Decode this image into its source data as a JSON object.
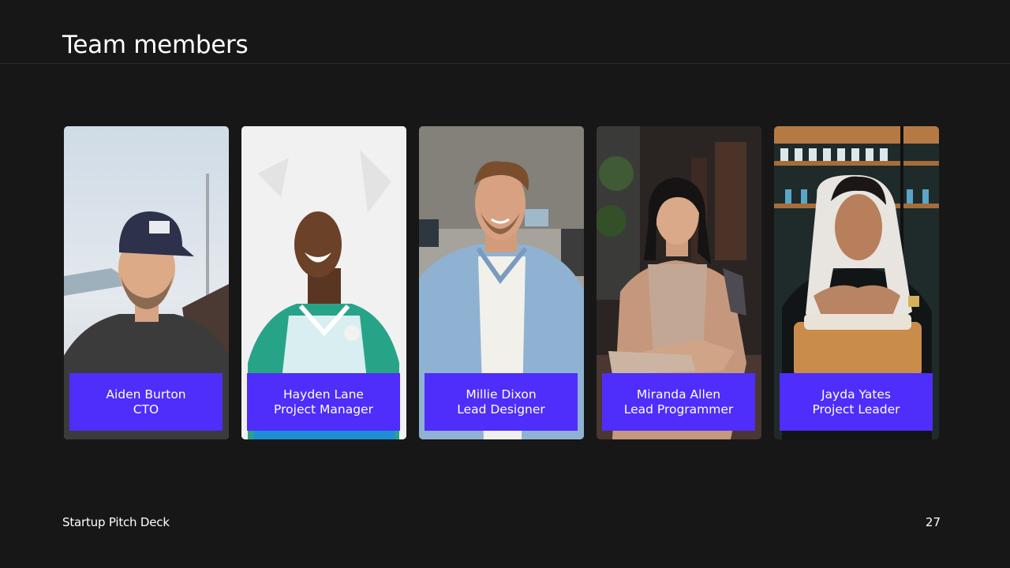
{
  "slide": {
    "title": "Team members",
    "footer_label": "Startup Pitch Deck",
    "page_number": "27"
  },
  "colors": {
    "background": "#171717",
    "caption_bg": "#4f2dfa",
    "text": "#ffffff"
  },
  "members": [
    {
      "name": "Aiden Burton",
      "role": "CTO",
      "photo": "man-in-cap-photo"
    },
    {
      "name": "Hayden Lane",
      "role": "Project Manager",
      "photo": "man-in-jersey-photo"
    },
    {
      "name": "Millie Dixon",
      "role": "Lead Designer",
      "photo": "man-in-denim-shirt-photo"
    },
    {
      "name": "Miranda Allen",
      "role": "Lead Programmer",
      "photo": "woman-in-cafe-photo"
    },
    {
      "name": "Jayda Yates",
      "role": "Project Leader",
      "photo": "woman-in-headscarf-photo"
    }
  ]
}
